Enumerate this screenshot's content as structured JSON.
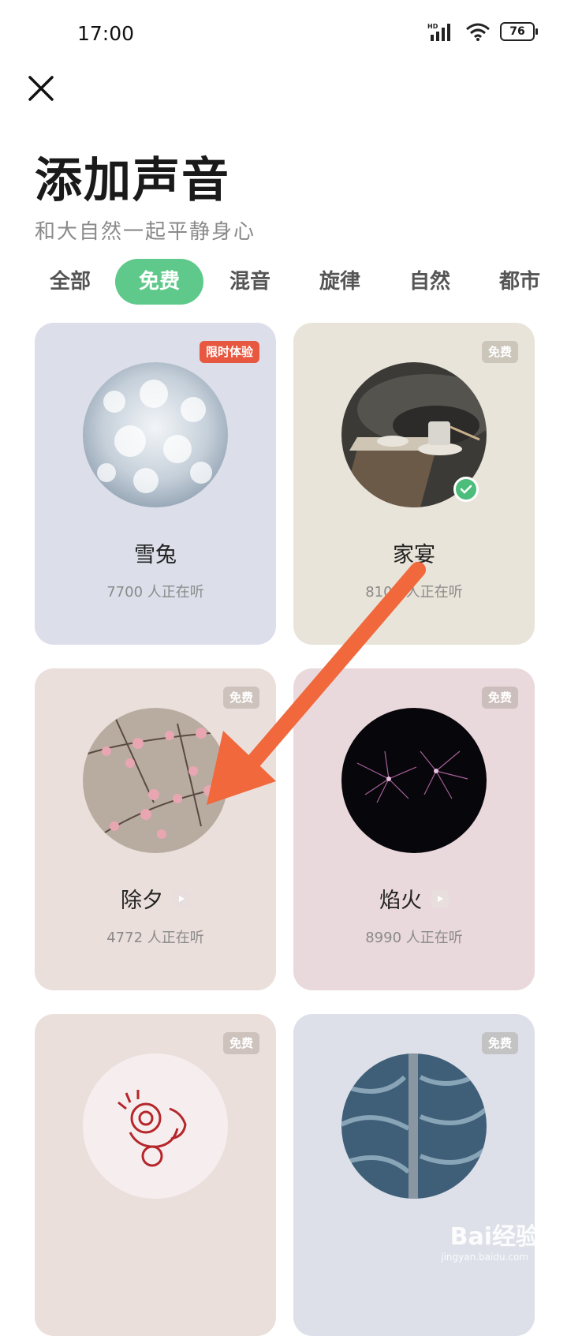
{
  "status": {
    "time": "17:00",
    "battery": "76",
    "network": "HD"
  },
  "header": {
    "title": "添加声音",
    "subtitle": "和大自然一起平静身心"
  },
  "tabs": [
    "全部",
    "免费",
    "混音",
    "旋律",
    "自然",
    "都市"
  ],
  "active_tab": "免费",
  "cards": [
    {
      "name": "雪兔",
      "listeners": "7700 人正在听",
      "badge": "限时体验",
      "bg": "#dcdfea",
      "selected": false,
      "has_play": false
    },
    {
      "name": "家宴",
      "listeners": "8104 人正在听",
      "badge": "免费",
      "bg": "#e9e4d9",
      "selected": true,
      "has_play": false
    },
    {
      "name": "除夕",
      "listeners": "4772 人正在听",
      "badge": "免费",
      "bg": "#ebdfdc",
      "selected": false,
      "has_play": true
    },
    {
      "name": "焰火",
      "listeners": "8990 人正在听",
      "badge": "免费",
      "bg": "#ead9dc",
      "selected": false,
      "has_play": true
    },
    {
      "name": "",
      "listeners": "",
      "badge": "免费",
      "bg": "#ebdfdc",
      "selected": false,
      "has_play": false
    },
    {
      "name": "",
      "listeners": "",
      "badge": "免费",
      "bg": "#dde0e9",
      "selected": false,
      "has_play": false
    }
  ],
  "watermark": {
    "brand": "Bai经验",
    "url": "jingyan.baidu.com"
  },
  "colors": {
    "accent": "#5ec98a",
    "trial": "#e8573f",
    "arrow": "#f0683c"
  }
}
